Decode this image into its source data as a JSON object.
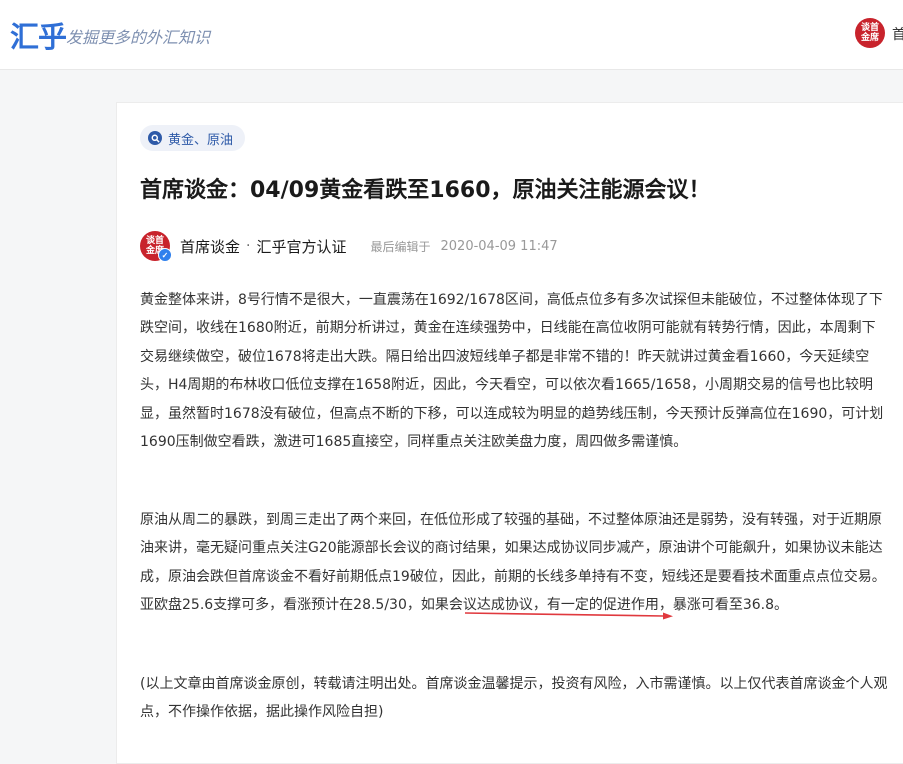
{
  "header": {
    "logo": "汇乎",
    "slogan": "发掘更多的外汇知识",
    "avatar_text": "谈首\n金席",
    "user_label": "首"
  },
  "article": {
    "tag_icon": "search-icon",
    "tag": "黄金、原油",
    "title": "首席谈金：04/09黄金看跌至1660，原油关注能源会议！",
    "author": {
      "avatar_text": "谈首\n金席",
      "name": "首席谈金",
      "separator": "·",
      "certification": "汇乎官方认证",
      "edit_label": "最后编辑于",
      "edit_time": "2020-04-09 11:47"
    },
    "paragraphs": [
      "黄金整体来讲，8号行情不是很大，一直震荡在1692/1678区间，高低点位多有多次试探但未能破位，不过整体体现了下跌空间，收线在1680附近，前期分析讲过，黄金在连续强势中，日线能在高位收阴可能就有转势行情，因此，本周剩下交易继续做空，破位1678将走出大跌。隔日给出四波短线单子都是非常不错的！昨天就讲过黄金看1660，今天延续空头，H4周期的布林收口低位支撑在1658附近，因此，今天看空，可以依次看1665/1658，小周期交易的信号也比较明显，虽然暂时1678没有破位，但高点不断的下移，可以连成较为明显的趋势线压制，今天预计反弹高位在1690，可计划1690压制做空看跌，激进可1685直接空，同样重点关注欧美盘力度，周四做多需谨慎。",
      "原油从周二的暴跌，到周三走出了两个来回，在低位形成了较强的基础，不过整体原油还是弱势，没有转强，对于近期原油来讲，毫无疑问重点关注G20能源部长会议的商讨结果，如果达成协议同步减产，原油讲个可能飙升，如果协议未能达成，原油会跌但首席谈金不看好前期低点19破位，因此，前期的长线多单持有不变，短线还是要看技术面重点点位交易。亚欧盘25.6支撑可多，看涨预计在28.5/30，如果会议达成协议，有一定的促进作用，暴涨可看至36.8。",
      "(以上文章由首席谈金原创，转载请注明出处。首席谈金温馨提示，投资有风险，入市需谨慎。以上仅代表首席谈金个人观点，不作操作依据，据此操作风险自担)"
    ],
    "annotation_color": "#e0393e"
  },
  "colors": {
    "brand_blue": "#2f6fd6",
    "avatar_red": "#c8232c",
    "tag_bg": "#eef1f8",
    "tag_text": "#2e5aa8"
  }
}
